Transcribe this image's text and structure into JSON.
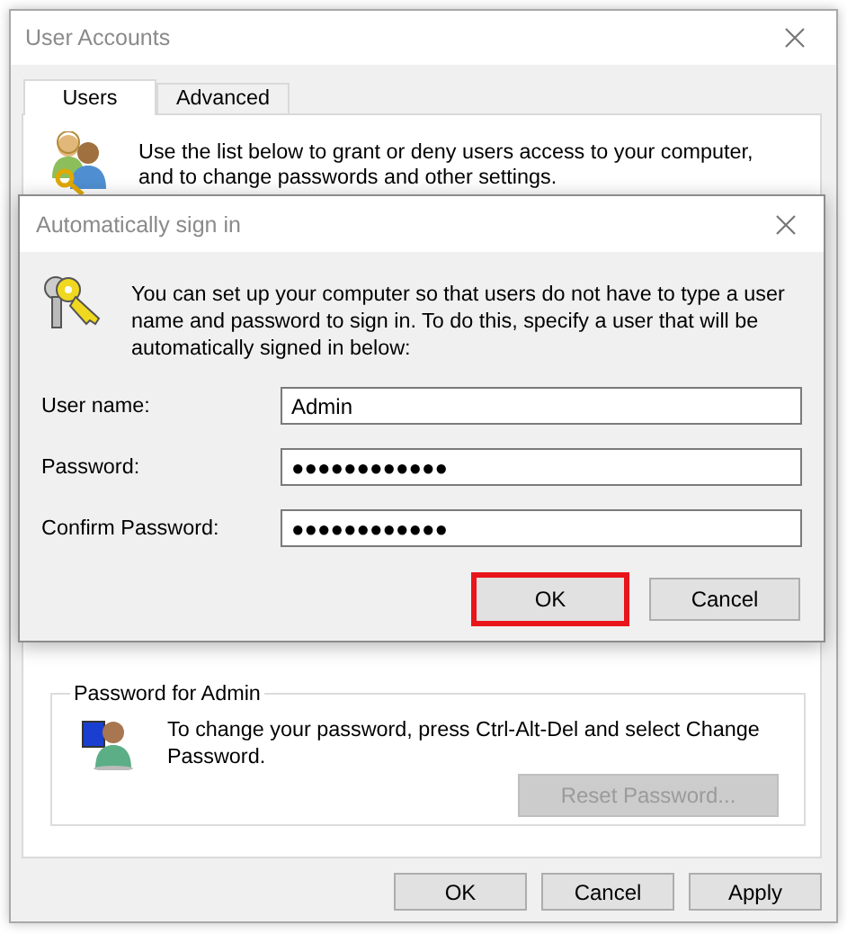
{
  "window": {
    "title": "User Accounts"
  },
  "tabs": [
    {
      "label": "Users",
      "selected": true
    },
    {
      "label": "Advanced",
      "selected": false
    }
  ],
  "intro": "Use the list below to grant or deny users access to your computer, and to change passwords and other settings.",
  "password_group": {
    "title": "Password for Admin",
    "text": "To change your password, press Ctrl-Alt-Del and select Change Password.",
    "button": {
      "label": "Reset Password...",
      "disabled": true
    }
  },
  "buttons": [
    {
      "label": "OK",
      "disabled": false
    },
    {
      "label": "Cancel",
      "disabled": false
    },
    {
      "label": "Apply",
      "disabled": false
    }
  ],
  "dialog": {
    "title": "Automatically sign in",
    "text": "You can set up your computer so that users do not have to type a user name and password to sign in. To do this, specify a user that will be automatically signed in below:",
    "fields": [
      {
        "label": "User name:",
        "value": "Admin"
      },
      {
        "label": "Password:",
        "value": "●●●●●●●●●●●●"
      },
      {
        "label": "Confirm Password:",
        "value": "●●●●●●●●●●●●"
      }
    ],
    "buttons": [
      {
        "label": "OK",
        "highlighted": true
      },
      {
        "label": "Cancel",
        "highlighted": false
      }
    ]
  }
}
